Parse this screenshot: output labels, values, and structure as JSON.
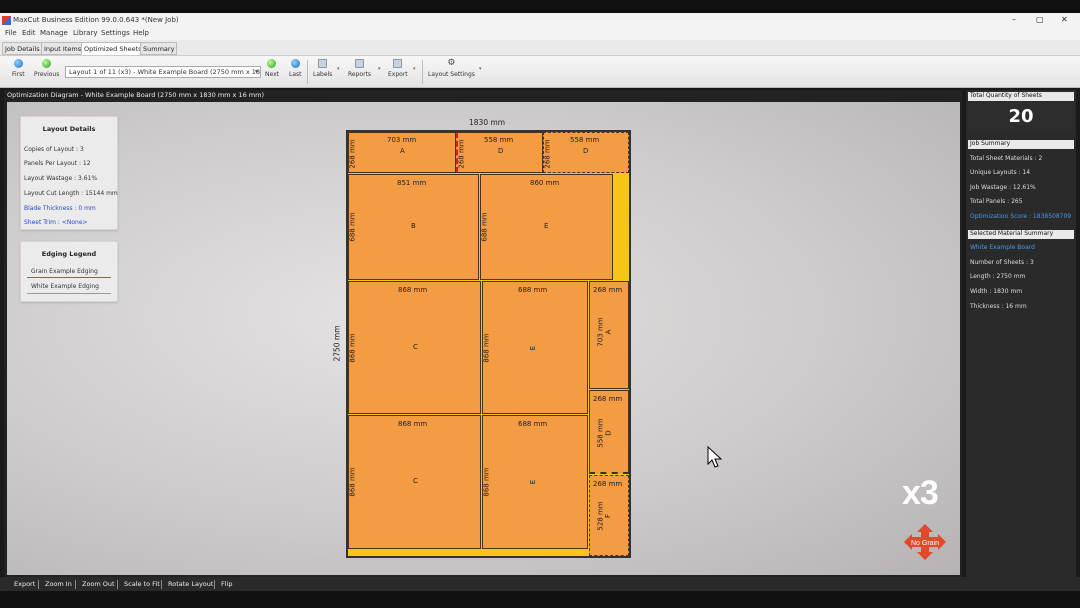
{
  "window": {
    "title": "MaxCut Business Edition 99.0.0.643 *(New Job)",
    "controls": [
      "–",
      "▢",
      "✕"
    ]
  },
  "menu": [
    "File",
    "Edit",
    "Manage",
    "Library",
    "Settings",
    "Help"
  ],
  "tabs": [
    "Job Details",
    "Input Items",
    "Optimized Sheets",
    "Summary"
  ],
  "active_tab": "Optimized Sheets",
  "toolbar": {
    "first": "First",
    "previous": "Previous",
    "layout_select": "Layout 1 of 11 (x3) - White Example Board (2750 mm x 1830 ...",
    "next": "Next",
    "last": "Last",
    "labels": "Labels",
    "reports": "Reports",
    "export": "Export",
    "layout_settings": "Layout Settings"
  },
  "diagram": {
    "header": "Optimization Diagram - White Example Board (2750 mm x 1830 mm x 16 mm)",
    "sheet_width_label": "1830 mm",
    "sheet_length_label": "2750 mm",
    "copies_badge": "x3",
    "grain_badge": "No Grain",
    "panels": [
      {
        "h": "703 mm",
        "v": "268 mm",
        "id": "A"
      },
      {
        "h": "558 mm",
        "v": "268 mm",
        "id": "D"
      },
      {
        "h": "558 mm",
        "v": "268 mm",
        "id": "D"
      },
      {
        "h": "851 mm",
        "v": "688 mm",
        "id": "B"
      },
      {
        "h": "860 mm",
        "v": "688 mm",
        "id": "E"
      },
      {
        "h": "868 mm",
        "v": "868 mm",
        "id": "C"
      },
      {
        "h": "688 mm",
        "v": "868 mm",
        "id": "E"
      },
      {
        "h": "268 mm",
        "v": "703 mm",
        "id": "A"
      },
      {
        "h": "268 mm",
        "v": "558 mm",
        "id": "D"
      },
      {
        "h": "868 mm",
        "v": "868 mm",
        "id": "C"
      },
      {
        "h": "688 mm",
        "v": "868 mm",
        "id": "E"
      },
      {
        "h": "268 mm",
        "v": "528 mm",
        "id": "F"
      }
    ]
  },
  "layout_details": {
    "title": "Layout Details",
    "copies": "Copies of Layout :  3",
    "panels_per_layout": "Panels Per Layout :  12",
    "wastage": "Layout Wastage :  3.61%",
    "cut_length": "Layout Cut Length :  15144 mm",
    "blade": "Blade Thickness :  0 mm",
    "trim": "Sheet Trim :  <None>"
  },
  "edging_legend": {
    "title": "Edging Legend",
    "items": [
      "Grain Example Edging",
      "White Example Edging"
    ]
  },
  "sidebar": {
    "total_qty_label": "Total Quantity of Sheets",
    "total_qty": "20",
    "job_summary_label": "Job Summary",
    "job_rows": [
      "Total Sheet Materials :  2",
      "Unique Layouts :  14",
      "Job Wastage :  12.61%",
      "Total Panels :  265"
    ],
    "optimization_score": "Optimization Score :  1838508709",
    "material_label": "Selected Material Summary",
    "material_name": "White Example Board",
    "material_rows": [
      "Number of Sheets :  3",
      "Length :  2750 mm",
      "Width :  1830 mm",
      "Thickness :  16 mm"
    ]
  },
  "bottom_toolbar": [
    "Export",
    "Zoom In",
    "Zoom Out",
    "Scale to Fit",
    "Rotate Layout",
    "Flip"
  ],
  "colors": {
    "panel": "#f39c44",
    "sheet_waste": "#f5c518",
    "link": "#2b49c9",
    "sidebar_link": "#4a9be8"
  }
}
